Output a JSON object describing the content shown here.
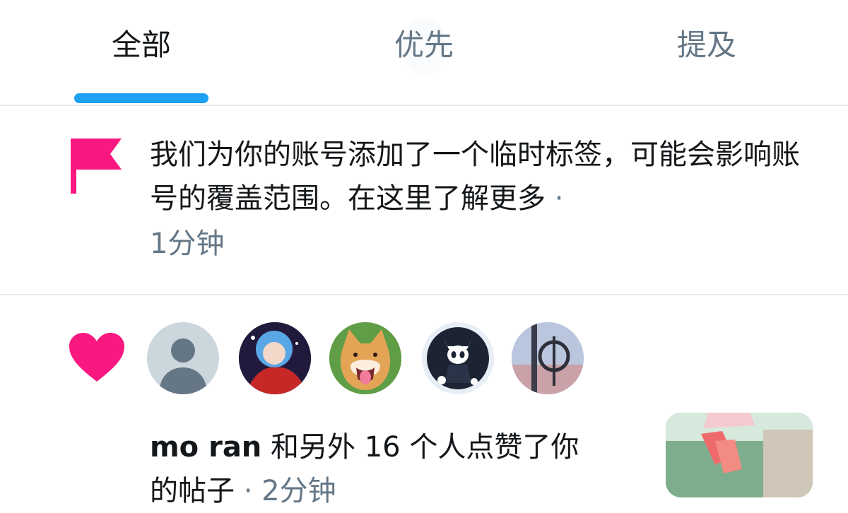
{
  "tabs": [
    {
      "label": "全部",
      "active": true
    },
    {
      "label": "优先",
      "active": false
    },
    {
      "label": "提及",
      "active": false
    }
  ],
  "notice": {
    "icon": "flag-icon",
    "text": "我们为你的账号添加了一个临时标签，可能会影响账号的覆盖范围。在这里了解更多",
    "separator": "·",
    "time": "1分钟"
  },
  "like_notification": {
    "icon": "heart-icon",
    "avatars": [
      "default-avatar",
      "anime-avatar",
      "dog-avatar",
      "knight-avatar",
      "photo-avatar"
    ],
    "user": "mo ran",
    "text": " 和另外 16 个人点赞了你",
    "text_line2": "的帖子",
    "separator": " · ",
    "time": "2分钟"
  },
  "colors": {
    "accent": "#1da1f2",
    "like": "#f91880",
    "secondary_text": "#657786",
    "divider": "#e6ecf0"
  }
}
